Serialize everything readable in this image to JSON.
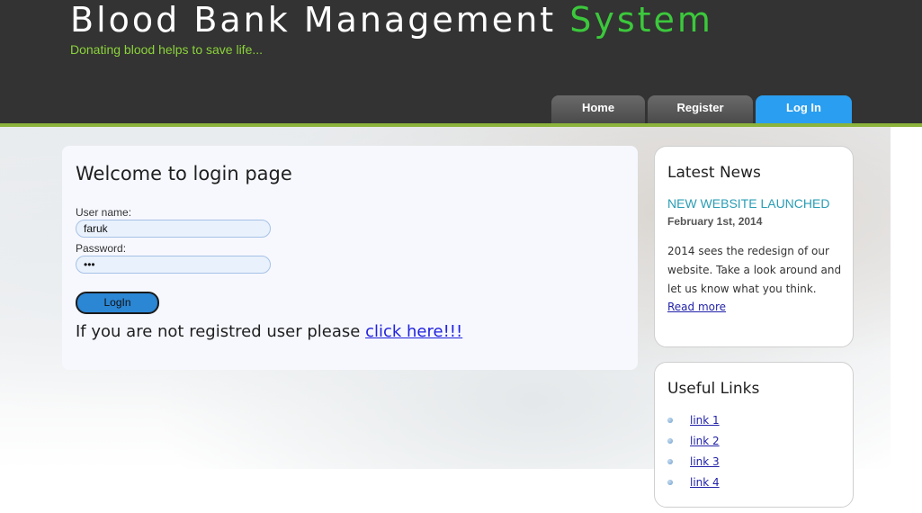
{
  "header": {
    "title_main": "Blood Bank Management ",
    "title_accent": "System",
    "slogan": "Donating blood helps to save life..."
  },
  "menu": {
    "items": [
      {
        "label": "Home"
      },
      {
        "label": "Register"
      },
      {
        "label": "Log In"
      }
    ],
    "active": "Log In"
  },
  "login": {
    "title": "Welcome to login page",
    "username_label": "User name:",
    "username_value": "faruk",
    "password_label": "Password:",
    "password_value": "•••",
    "button_label": "LogIn",
    "register_prompt": "If you are not registred user please ",
    "register_link": "click here!!!"
  },
  "news": {
    "title": "Latest News",
    "headline": "NEW WEBSITE LAUNCHED",
    "date": "February 1st, 2014",
    "body": "2014 sees the redesign of our website. Take a look around and let us know what you think.",
    "read_more": "Read more"
  },
  "links": {
    "title": "Useful Links",
    "items": [
      "link 1",
      "link 2",
      "link 3",
      "link 4"
    ]
  },
  "colors": {
    "header_bg": "#323332",
    "accent_green": "#3cc83c",
    "active_tab": "#2a9ef0",
    "news_headline": "#2a9db4"
  }
}
